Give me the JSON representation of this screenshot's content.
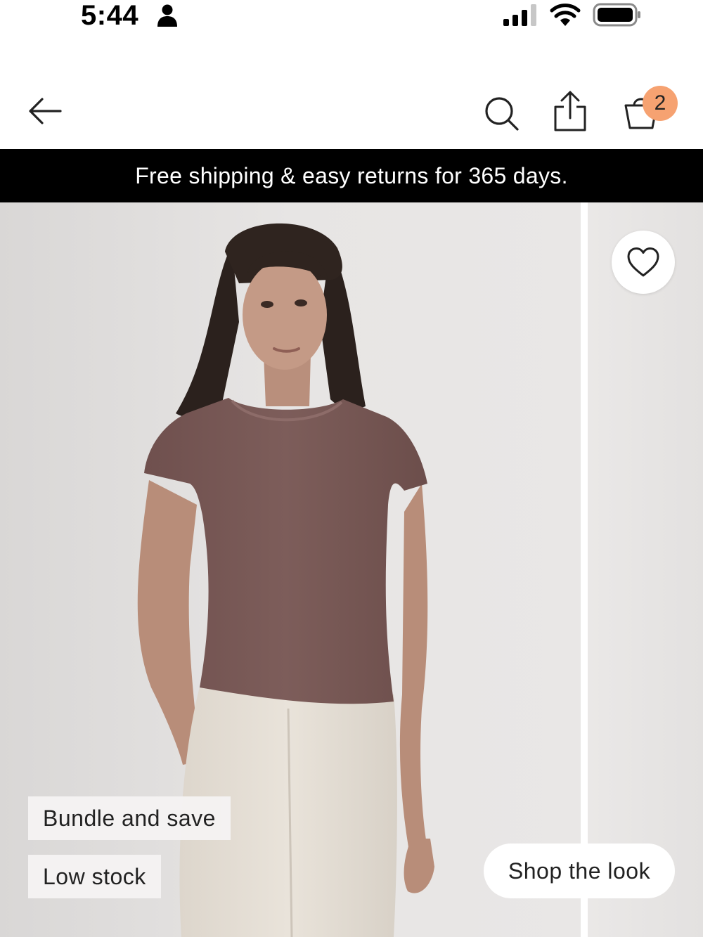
{
  "status_bar": {
    "time": "5:44",
    "icons": [
      "person-icon",
      "signal-icon",
      "wifi-icon",
      "battery-icon"
    ]
  },
  "nav": {
    "icons": [
      "back-arrow-icon",
      "search-icon",
      "share-icon",
      "shopping-bag-icon"
    ],
    "cart_count": "2",
    "badge_color": "#f6a271"
  },
  "promo": {
    "text": "Free shipping & easy returns for 365 days.",
    "background": "#000000"
  },
  "product_gallery": {
    "favorite_icon": "heart-icon",
    "tags": [
      "Bundle and save",
      "Low stock"
    ],
    "shop_the_look_label": "Shop the look",
    "shirt_color": "#7a5a57"
  }
}
